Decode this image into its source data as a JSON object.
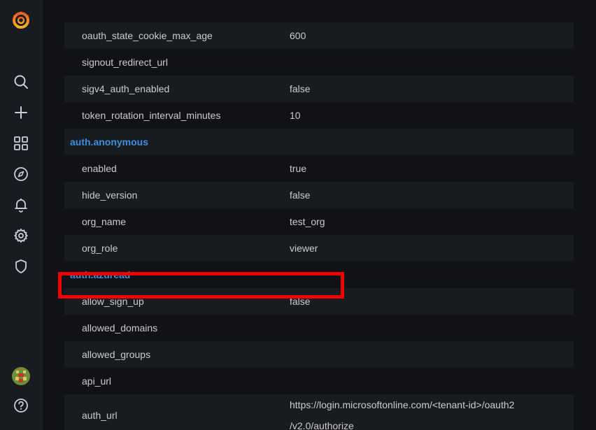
{
  "sidebar": {
    "logo": "grafana-logo-icon",
    "items": [
      {
        "icon": "search-icon"
      },
      {
        "icon": "plus-icon"
      },
      {
        "icon": "dashboards-grid-icon"
      },
      {
        "icon": "explore-compass-icon"
      },
      {
        "icon": "alerting-bell-icon"
      },
      {
        "icon": "configuration-gear-icon"
      },
      {
        "icon": "server-admin-shield-icon"
      }
    ],
    "bottom": [
      {
        "icon": "user-avatar-icon"
      },
      {
        "icon": "help-question-icon"
      }
    ]
  },
  "settings": {
    "rows": [
      {
        "key": "",
        "value": ""
      },
      {
        "key": "oauth_state_cookie_max_age",
        "value": "600"
      },
      {
        "key": "signout_redirect_url",
        "value": ""
      },
      {
        "key": "sigv4_auth_enabled",
        "value": "false"
      },
      {
        "key": "token_rotation_interval_minutes",
        "value": "10"
      }
    ],
    "anonymous": {
      "section": "auth.anonymous",
      "rows": [
        {
          "key": "enabled",
          "value": "true"
        },
        {
          "key": "hide_version",
          "value": "false"
        },
        {
          "key": "org_name",
          "value": "test_org"
        },
        {
          "key": "org_role",
          "value": "viewer"
        }
      ]
    },
    "azuread": {
      "section": "auth.azuread",
      "rows": [
        {
          "key": "allow_sign_up",
          "value": "false"
        },
        {
          "key": "allowed_domains",
          "value": ""
        },
        {
          "key": "allowed_groups",
          "value": ""
        },
        {
          "key": "api_url",
          "value": ""
        }
      ],
      "auth_url": {
        "key": "auth_url",
        "value_line1": "https://login.microsoftonline.com/<tenant-id>/oauth2",
        "value_line2": "/v2.0/authorize"
      }
    }
  },
  "colors": {
    "accent": "#3d8fd9",
    "highlight": "#ee0000",
    "background": "#111217",
    "row_alt": "#181b1f"
  }
}
